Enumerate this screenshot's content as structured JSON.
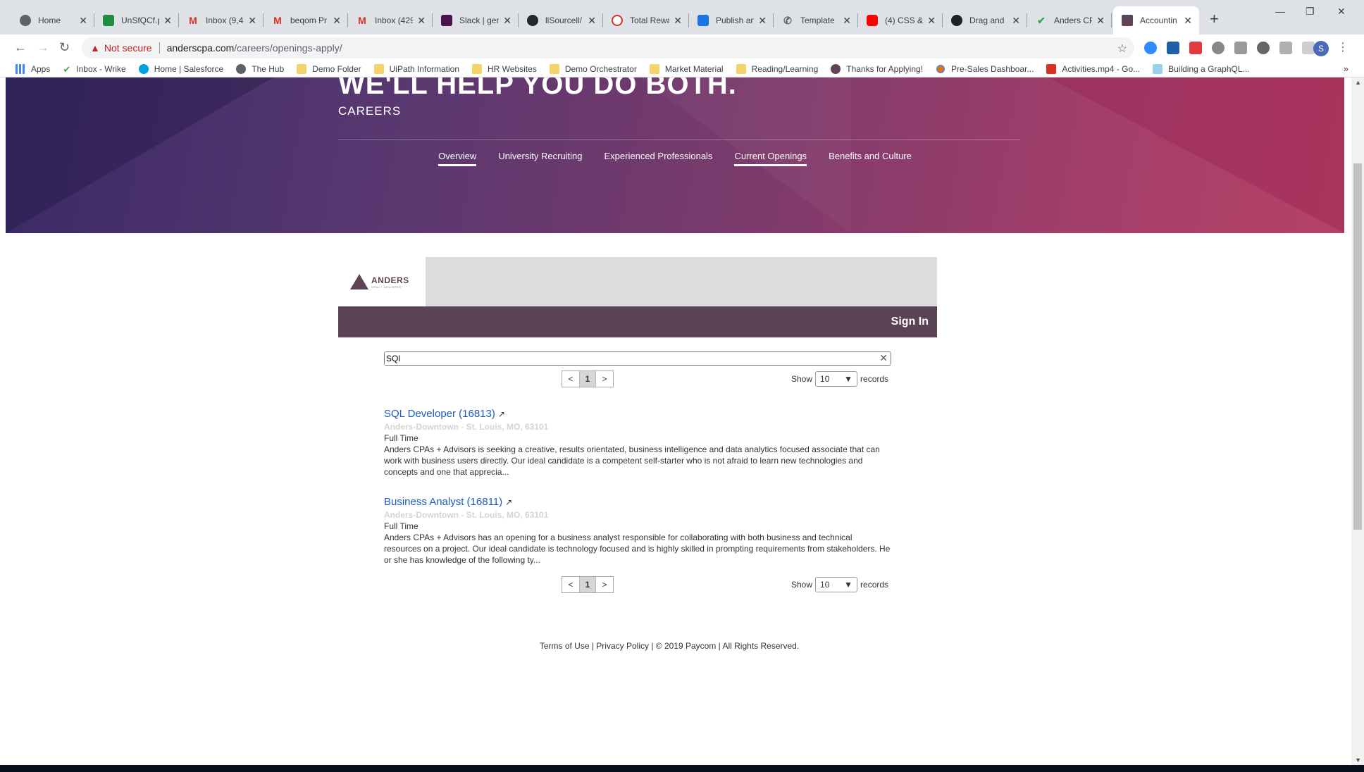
{
  "browser": {
    "tabs": [
      {
        "label": "Home",
        "color": "#5f6368"
      },
      {
        "label": "UnSfQCf.p",
        "color": "#1e8e3e"
      },
      {
        "label": "Inbox (9,4",
        "color": "#d93025"
      },
      {
        "label": "beqom Pr",
        "color": "#d93025"
      },
      {
        "label": "Inbox (429",
        "color": "#d93025"
      },
      {
        "label": "Slack | ger",
        "color": "#4a154b"
      },
      {
        "label": "llSourcell/",
        "color": "#24292e"
      },
      {
        "label": "Total Rewa",
        "color": "#d93025"
      },
      {
        "label": "Publish an",
        "color": "#1a73e8"
      },
      {
        "label": "Template",
        "color": "#5f6368"
      },
      {
        "label": "(4) CSS &",
        "color": "#ff0000"
      },
      {
        "label": "Drag and",
        "color": "#202124"
      },
      {
        "label": "Anders CP",
        "color": "#34a853"
      },
      {
        "label": "Accountin",
        "color": "#5d4458"
      }
    ],
    "new_tab": "+",
    "url_warning": "Not secure",
    "url_host": "anderscpa.com",
    "url_path": "/careers/openings-apply/",
    "profile_initial": "S",
    "bookmarks": [
      "Apps",
      "Inbox - Wrike",
      "Home | Salesforce",
      "The Hub",
      "Demo Folder",
      "UiPath Information",
      "HR Websites",
      "Demo Orchestrator",
      "Market Material",
      "Reading/Learning",
      "Thanks for Applying!",
      "Pre-Sales Dashboar...",
      "Activities.mp4 - Go...",
      "Building a GraphQL..."
    ],
    "bookmarks_more": "»"
  },
  "hero": {
    "tagline": "WE'LL HELP YOU DO BOTH.",
    "section": "CAREERS",
    "nav": [
      "Overview",
      "University Recruiting",
      "Experienced Professionals",
      "Current Openings",
      "Benefits and Culture"
    ]
  },
  "board": {
    "logo_name": "ANDERS",
    "logo_sub": "CPAs + ADVISORS",
    "sign_in": "Sign In",
    "search_value": "SQl",
    "pager": {
      "prev": "<",
      "page": "1",
      "next": ">"
    },
    "show_label": "Show",
    "show_value": "10",
    "records_label": "records",
    "jobs": [
      {
        "title": "SQL Developer (16813)",
        "location": "Anders-Downtown - St. Louis, MO, 63101",
        "type": "Full Time",
        "description": "Anders CPAs + Advisors is seeking a creative, results orientated, business intelligence and data analytics focused associate that can work with business users directly. Our ideal candidate is a competent self-starter who is not afraid to learn new technologies and concepts and one that apprecia..."
      },
      {
        "title": "Business Analyst (16811)",
        "location": "Anders-Downtown - St. Louis, MO, 63101",
        "type": "Full Time",
        "description": "Anders CPAs + Advisors has an opening for a business analyst responsible for collaborating with both business and technical resources on a project. Our ideal candidate is technology focused and is highly skilled in prompting requirements from stakeholders. He or she has knowledge of the following ty..."
      }
    ]
  },
  "footer": {
    "terms": "Terms of Use",
    "privacy": "Privacy Policy",
    "copyright": "© 2019 Paycom",
    "rights": "All Rights Reserved."
  }
}
